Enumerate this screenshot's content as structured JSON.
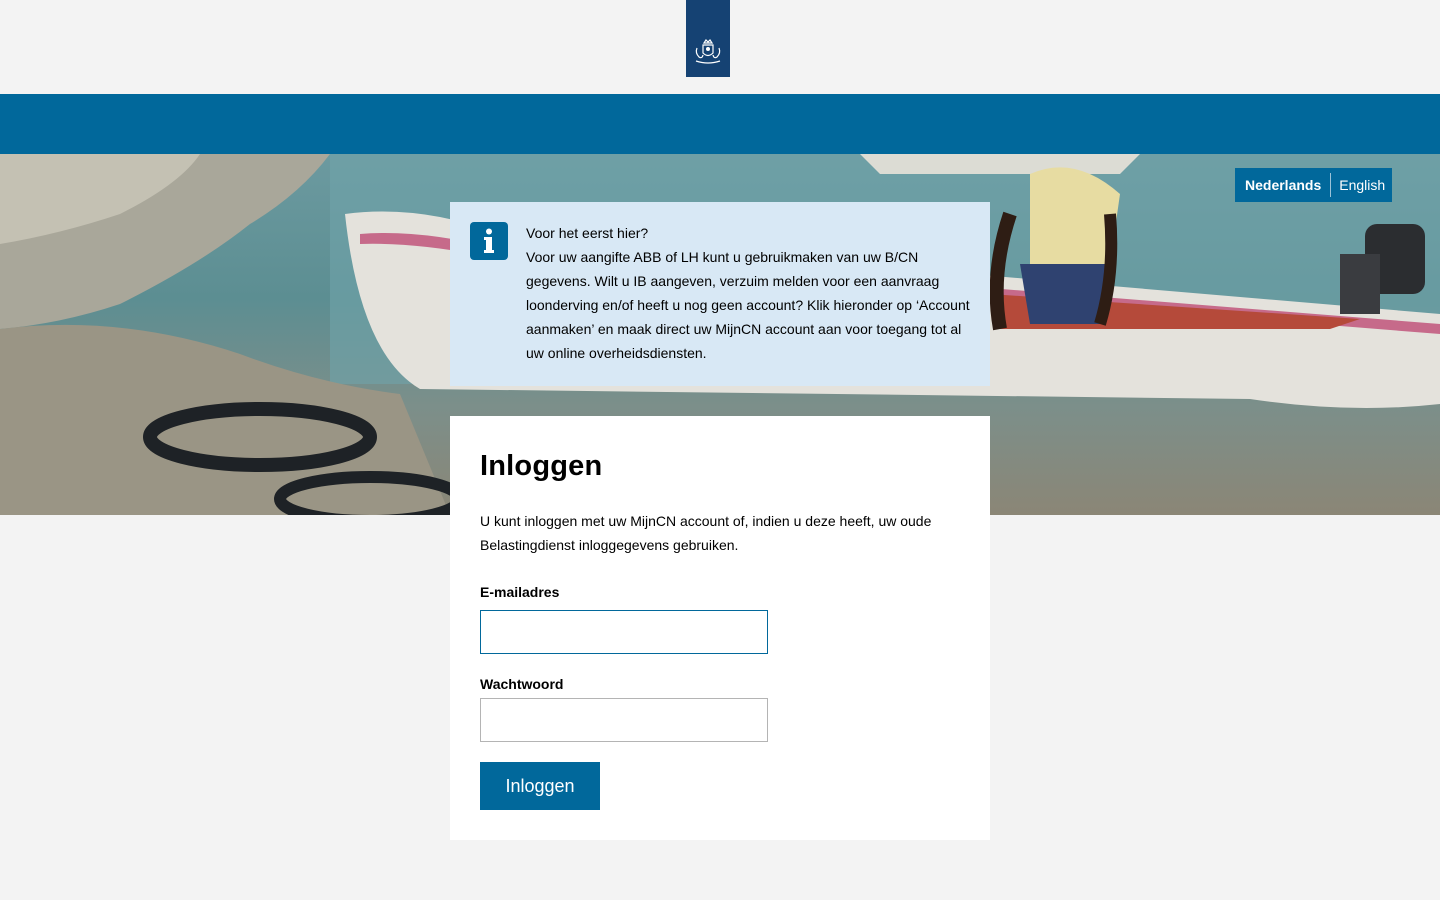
{
  "header": {
    "logo_name": "rijksoverheid-logo",
    "colors": {
      "logo_bg": "#154273",
      "bar": "#01689b"
    }
  },
  "language": {
    "current": "Nederlands",
    "other": "English"
  },
  "info": {
    "icon": "info-icon",
    "title": "Voor het eerst hier?",
    "body": "Voor uw aangifte ABB of LH kunt u gebruikmaken van uw B/CN gegevens. Wilt u IB aangeven, verzuim melden voor een aanvraag loonderving en/of heeft u nog geen account? Klik hieronder op ‘Account aanmaken’ en maak direct uw MijnCN account aan voor toegang tot al uw online overheidsdiensten."
  },
  "login": {
    "title": "Inloggen",
    "intro": "U kunt inloggen met uw MijnCN account of, indien u deze heeft, uw oude Belastingdienst inloggegevens gebruiken.",
    "email_label": "E-mailadres",
    "email_value": "",
    "password_label": "Wachtwoord",
    "password_value": "",
    "submit_label": "Inloggen"
  }
}
